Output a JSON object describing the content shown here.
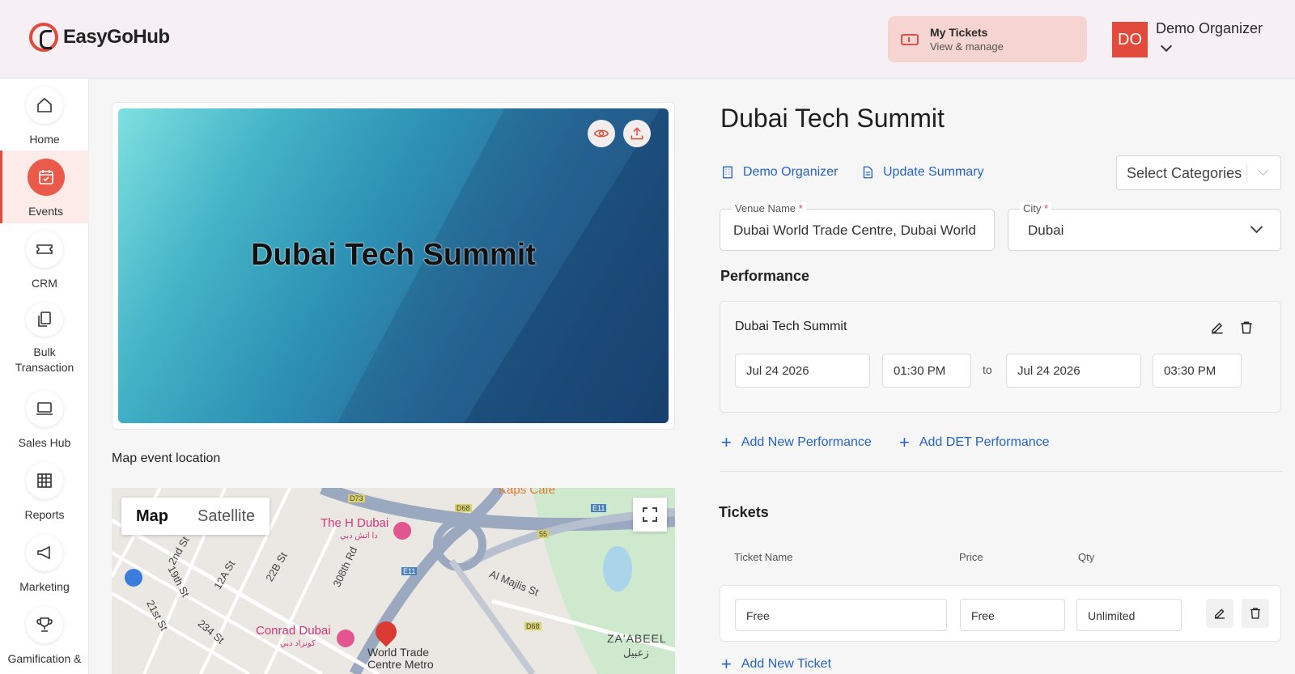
{
  "header": {
    "logo_text": "EasyGoHub",
    "my_tickets": {
      "title": "My Tickets",
      "subtitle": "View & manage",
      "icon": "ticket-icon"
    },
    "user": {
      "initials": "DO",
      "name": "Demo Organizer",
      "avatar_color": "#e24a3b"
    }
  },
  "sidebar": {
    "items": [
      {
        "label": "Home",
        "icon": "home-icon",
        "active": false
      },
      {
        "label": "Events",
        "icon": "calendar-icon",
        "active": true
      },
      {
        "label": "CRM",
        "icon": "crm-ticket-icon",
        "active": false
      },
      {
        "label": "Bulk Transaction",
        "icon": "documents-icon",
        "active": false
      },
      {
        "label": "Sales Hub",
        "icon": "laptop-icon",
        "active": false
      },
      {
        "label": "Reports",
        "icon": "table-icon",
        "active": false
      },
      {
        "label": "Marketing",
        "icon": "megaphone-icon",
        "active": false
      },
      {
        "label": "Gamification &",
        "icon": "trophy-icon",
        "active": false
      }
    ]
  },
  "banner": {
    "title": "Dubai Tech Summit"
  },
  "map": {
    "label": "Map event location",
    "tabs": [
      "Map",
      "Satellite"
    ],
    "pois": [
      "The H Dubai",
      "Conrad Dubai",
      "Kaps Cafe"
    ],
    "pois_ar": [
      "دا اتش دبي",
      "كونراد دبي"
    ],
    "roads": [
      "308th Rd",
      "Al Majlis St",
      "22B St",
      "12A St",
      "19th St",
      "21st St",
      "234 St",
      "2nd St"
    ],
    "road_shields": [
      "D73",
      "D68",
      "E11",
      "55",
      "E11",
      "D68"
    ],
    "area": "ZA'ABEEL",
    "area_ar": "زعبيل",
    "metro": "World Trade Centre Metro"
  },
  "event": {
    "title": "Dubai Tech Summit",
    "organizer_link": "Demo Organizer",
    "update_summary_link": "Update Summary",
    "categories_placeholder": "Select Categories",
    "venue": {
      "label": "Venue Name",
      "value": "Dubai World Trade Centre, Dubai World"
    },
    "city": {
      "label": "City",
      "value": "Dubai"
    }
  },
  "performance": {
    "section_title": "Performance",
    "name": "Dubai Tech Summit",
    "start_date": "Jul 24 2026",
    "start_time": "01:30 PM",
    "to_label": "to",
    "end_date": "Jul 24 2026",
    "end_time": "03:30 PM",
    "add_new": "Add New Performance",
    "add_det": "Add DET Performance"
  },
  "tickets": {
    "section_title": "Tickets",
    "columns": [
      "Ticket Name",
      "Price",
      "Qty"
    ],
    "rows": [
      {
        "name": "Free",
        "price": "Free",
        "qty": "Unlimited"
      }
    ],
    "add_new": "Add New Ticket"
  },
  "colors": {
    "accent": "#e24a3b",
    "link": "#2563c9",
    "header_bg": "#f6eff3"
  }
}
